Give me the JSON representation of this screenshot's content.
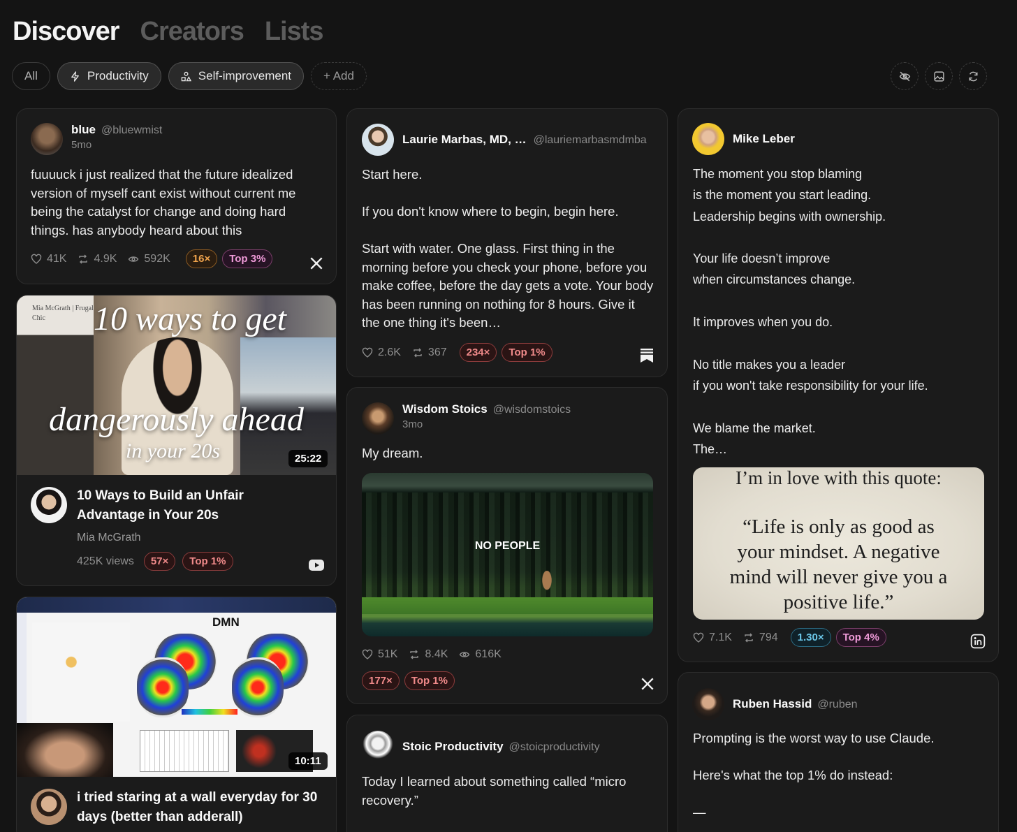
{
  "tabs": [
    "Discover",
    "Creators",
    "Lists"
  ],
  "filters": {
    "all": "All",
    "productivity": "Productivity",
    "self_improvement": "Self-improvement",
    "add": "+ Add"
  },
  "toolbar_icons": [
    "eye-off-icon",
    "image-icon",
    "refresh-icon"
  ],
  "posts": {
    "blue": {
      "name": "blue",
      "handle": "@bluewmist",
      "age": "5mo",
      "text": "fuuuuck i just realized that the future idealized version of myself cant exist without current me being the catalyst for change and doing hard things. has anybody heard about this",
      "likes": "41K",
      "reposts": "4.9K",
      "views": "592K",
      "multiplier": "16×",
      "rank": "Top 3%",
      "platform": "x"
    },
    "laurie": {
      "name": "Laurie Marbas, MD, …",
      "handle": "@lauriemarbasmdmba",
      "text": "Start here.\n\nIf you don't know where to begin, begin here.\n\nStart with water. One glass. First thing in the morning before you check your phone, before you make coffee, before the day gets a vote. Your body has been running on nothing for 8 hours. Give it the one thing it's been…",
      "likes": "2.6K",
      "reposts": "367",
      "multiplier": "234×",
      "rank": "Top 1%",
      "platform": "substack"
    },
    "mike": {
      "name": "Mike Leber",
      "text": "The moment you stop blaming\nis the moment you start leading.\nLeadership begins with ownership.\n\nYour life doesn’t improve\nwhen circumstances change.\n\nIt improves when you do.\n\nNo title makes you a leader\nif you won't take responsibility for your life.\n\nWe blame the market.\nThe…",
      "image_heading": "I’m in love with this quote:",
      "image_quote": "“Life is only as good as your mindset. A negative mind will never give you a positive life.”",
      "likes": "7.1K",
      "reposts": "794",
      "multiplier": "1.30×",
      "rank": "Top 4%",
      "platform": "linkedin"
    },
    "wisdom": {
      "name": "Wisdom Stoics",
      "handle": "@wisdomstoics",
      "age": "3mo",
      "text": "My dream.",
      "image_caption": "NO PEOPLE",
      "likes": "51K",
      "reposts": "8.4K",
      "views": "616K",
      "multiplier": "177×",
      "rank": "Top 1%",
      "platform": "x"
    },
    "stoic": {
      "name": "Stoic Productivity",
      "handle": "@stoicproductivity",
      "text": "Today I learned about something called “micro recovery.”"
    },
    "ruben": {
      "name": "Ruben Hassid",
      "handle": "@ruben",
      "text": "Prompting is the worst way to use Claude.\n\nHere's what the top 1% do instead:\n\n—"
    }
  },
  "videos": {
    "mia": {
      "thumb_brand": "Mia McGrath | Frugal Chic",
      "thumb_title_1": "10 ways to get",
      "thumb_title_2": "dangerously ahead",
      "thumb_title_3": "in your 20s",
      "duration": "25:22",
      "title": "10 Ways to Build an Unfair Advantage in Your 20s",
      "channel": "Mia McGrath",
      "views": "425K views",
      "multiplier": "57×",
      "rank": "Top 1%",
      "platform": "youtube"
    },
    "wall": {
      "thumb_label": "DMN",
      "duration": "10:11",
      "title": "i tried staring at a wall everyday for 30 days (better than adderall)"
    }
  },
  "colors": {
    "bg": "#141414",
    "card": "#1b1b1b",
    "orange": "#f0a44c",
    "red": "#f08a8a",
    "pink": "#ef9ad8",
    "blue": "#6cc8ea"
  }
}
